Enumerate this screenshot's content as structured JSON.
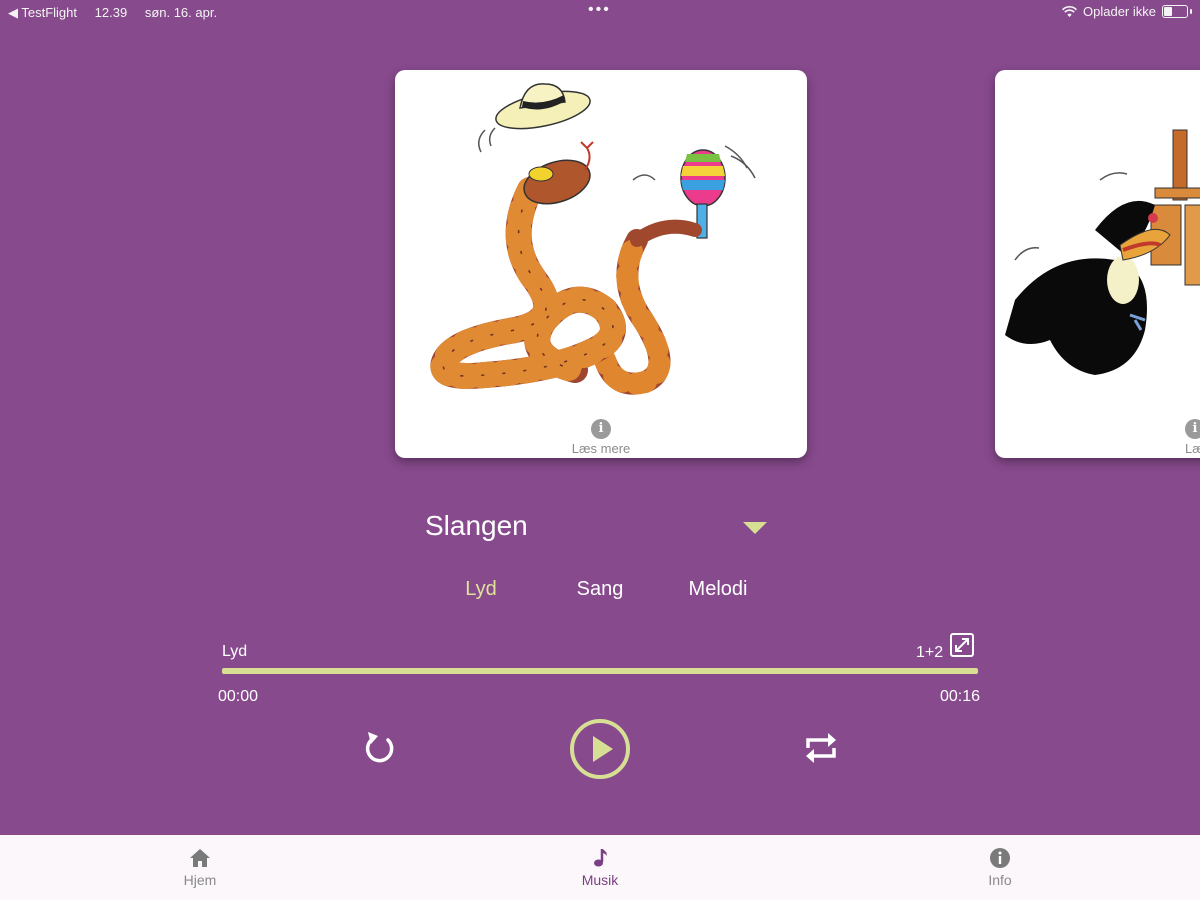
{
  "status_bar": {
    "back_app": "◀ TestFlight",
    "time": "12.39",
    "date": "søn. 16. apr.",
    "dots": "•••",
    "charging": "Oplader ikke"
  },
  "cards": {
    "main": {
      "read_more": "Læs mere",
      "info_glyph": "i"
    },
    "next": {
      "read_more": "Læs",
      "info_glyph": "i"
    }
  },
  "song_selector": {
    "title": "Slangen"
  },
  "tabs": [
    {
      "label": "Lyd",
      "active": true
    },
    {
      "label": "Sang",
      "active": false
    },
    {
      "label": "Melodi",
      "active": false
    }
  ],
  "player": {
    "track_label": "Lyd",
    "track_count": "1+2",
    "time_current": "00:00",
    "time_total": "00:16",
    "progress": 0
  },
  "bottom_nav": [
    {
      "label": "Hjem",
      "icon": "home-icon",
      "active": false
    },
    {
      "label": "Musik",
      "icon": "music-note-icon",
      "active": true
    },
    {
      "label": "Info",
      "icon": "info-icon",
      "active": false
    }
  ],
  "colors": {
    "background": "#874a8d",
    "accent": "#d7df94",
    "nav_active": "#7b3f83"
  }
}
